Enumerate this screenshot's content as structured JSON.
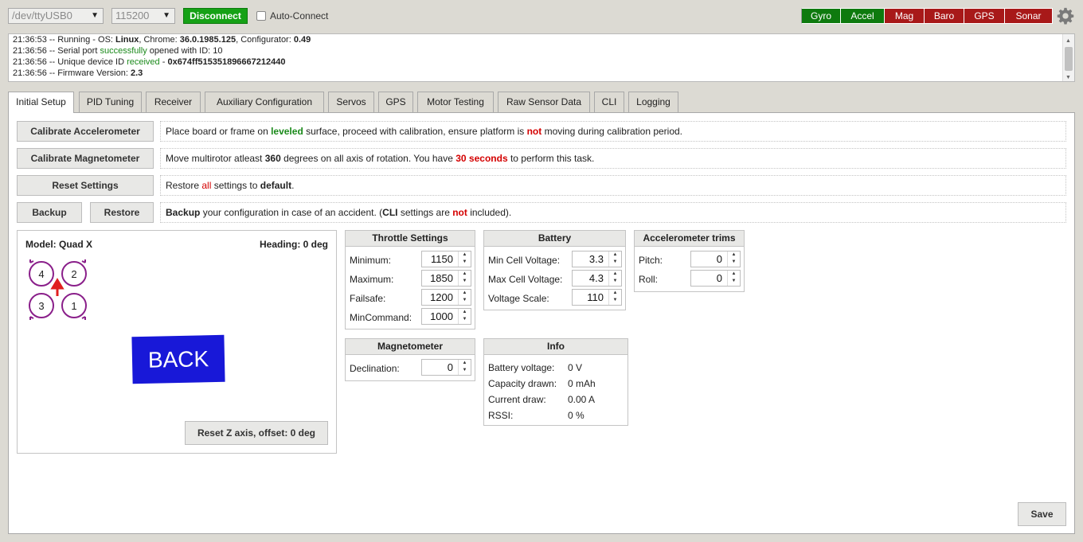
{
  "header": {
    "port": "/dev/ttyUSB0",
    "baud": "115200",
    "connect_label": "Disconnect",
    "autoconnect_label": "Auto-Connect",
    "sensors": [
      {
        "label": "Gyro",
        "color": "#0e7a0e"
      },
      {
        "label": "Accel",
        "color": "#0e7a0e"
      },
      {
        "label": "Mag",
        "color": "#a81919"
      },
      {
        "label": "Baro",
        "color": "#a81919"
      },
      {
        "label": "GPS",
        "color": "#a81919"
      },
      {
        "label": "Sonar",
        "color": "#a81919"
      }
    ],
    "settings_icon": "gear-icon"
  },
  "log": {
    "l1_prefix": "21:36:53 -- Running - OS: ",
    "l1_os": "Linux",
    "l1_mid": ", Chrome: ",
    "l1_chrome": "36.0.1985.125",
    "l1_mid2": ", Configurator: ",
    "l1_cfg": "0.49",
    "l2_prefix": "21:36:56 -- Serial port ",
    "l2_ok": "successfully",
    "l2_suffix": " opened with ID: 10",
    "l3_prefix": "21:36:56 -- Unique device ID ",
    "l3_ok": "received",
    "l3_suffix": " - ",
    "l3_id": "0x674ff515351896667212440",
    "l4_prefix": "21:36:56 -- Firmware Version: ",
    "l4_ver": "2.3"
  },
  "tabs": [
    {
      "label": "Initial Setup",
      "active": true
    },
    {
      "label": "PID Tuning"
    },
    {
      "label": "Receiver"
    },
    {
      "label": "Auxiliary Configuration"
    },
    {
      "label": "Servos"
    },
    {
      "label": "GPS"
    },
    {
      "label": "Motor Testing"
    },
    {
      "label": "Raw Sensor Data"
    },
    {
      "label": "CLI"
    },
    {
      "label": "Logging"
    }
  ],
  "actions": {
    "calib_acc": "Calibrate Accelerometer",
    "calib_acc_n1": "Place board or frame on ",
    "calib_acc_n2": "leveled",
    "calib_acc_n3": " surface, proceed with calibration, ensure platform is ",
    "calib_acc_n4": "not",
    "calib_acc_n5": " moving during calibration period.",
    "calib_mag": "Calibrate Magnetometer",
    "calib_mag_n1": "Move multirotor atleast ",
    "calib_mag_n2": "360",
    "calib_mag_n3": " degrees on all axis of rotation. You have ",
    "calib_mag_n4": "30 seconds",
    "calib_mag_n5": " to perform this task.",
    "reset": "Reset Settings",
    "reset_n1": "Restore ",
    "reset_n2": "all",
    "reset_n3": " settings to ",
    "reset_n4": "default",
    "reset_n5": ".",
    "backup": "Backup",
    "restore": "Restore",
    "backup_n1": "Backup",
    "backup_n2": " your configuration in case of an accident. (",
    "backup_n3": "CLI",
    "backup_n4": " settings are ",
    "backup_n5": "not",
    "backup_n6": " included)."
  },
  "model": {
    "name": "Model: Quad X",
    "heading": "Heading: 0 deg",
    "motors": [
      "4",
      "2",
      "3",
      "1"
    ],
    "back_label": "BACK",
    "reset_z": "Reset Z axis, offset: 0 deg"
  },
  "throttle": {
    "title": "Throttle Settings",
    "rows": [
      {
        "label": "Minimum:",
        "value": "1150"
      },
      {
        "label": "Maximum:",
        "value": "1850"
      },
      {
        "label": "Failsafe:",
        "value": "1200"
      },
      {
        "label": "MinCommand:",
        "value": "1000"
      }
    ]
  },
  "battery": {
    "title": "Battery",
    "rows": [
      {
        "label": "Min Cell Voltage:",
        "value": "3.3"
      },
      {
        "label": "Max Cell Voltage:",
        "value": "4.3"
      },
      {
        "label": "Voltage Scale:",
        "value": "110"
      }
    ]
  },
  "trims": {
    "title": "Accelerometer trims",
    "rows": [
      {
        "label": "Pitch:",
        "value": "0"
      },
      {
        "label": "Roll:",
        "value": "0"
      }
    ]
  },
  "mag": {
    "title": "Magnetometer",
    "label": "Declination:",
    "value": "0"
  },
  "info": {
    "title": "Info",
    "rows": [
      {
        "label": "Battery voltage:",
        "value": "0 V"
      },
      {
        "label": "Capacity drawn:",
        "value": "0 mAh"
      },
      {
        "label": "Current draw:",
        "value": "0.00 A"
      },
      {
        "label": "RSSI:",
        "value": "0 %"
      }
    ]
  },
  "save_label": "Save"
}
